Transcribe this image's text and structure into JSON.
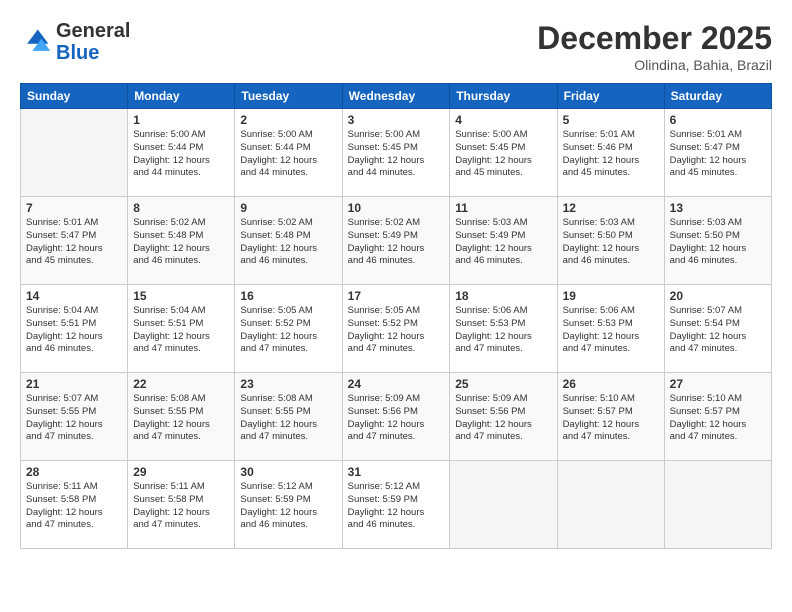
{
  "header": {
    "logo_line1": "General",
    "logo_line2": "Blue",
    "month": "December 2025",
    "location": "Olindina, Bahia, Brazil"
  },
  "weekdays": [
    "Sunday",
    "Monday",
    "Tuesday",
    "Wednesday",
    "Thursday",
    "Friday",
    "Saturday"
  ],
  "weeks": [
    [
      {
        "day": "",
        "info": ""
      },
      {
        "day": "1",
        "info": "Sunrise: 5:00 AM\nSunset: 5:44 PM\nDaylight: 12 hours\nand 44 minutes."
      },
      {
        "day": "2",
        "info": "Sunrise: 5:00 AM\nSunset: 5:44 PM\nDaylight: 12 hours\nand 44 minutes."
      },
      {
        "day": "3",
        "info": "Sunrise: 5:00 AM\nSunset: 5:45 PM\nDaylight: 12 hours\nand 44 minutes."
      },
      {
        "day": "4",
        "info": "Sunrise: 5:00 AM\nSunset: 5:45 PM\nDaylight: 12 hours\nand 45 minutes."
      },
      {
        "day": "5",
        "info": "Sunrise: 5:01 AM\nSunset: 5:46 PM\nDaylight: 12 hours\nand 45 minutes."
      },
      {
        "day": "6",
        "info": "Sunrise: 5:01 AM\nSunset: 5:47 PM\nDaylight: 12 hours\nand 45 minutes."
      }
    ],
    [
      {
        "day": "7",
        "info": "Sunrise: 5:01 AM\nSunset: 5:47 PM\nDaylight: 12 hours\nand 45 minutes."
      },
      {
        "day": "8",
        "info": "Sunrise: 5:02 AM\nSunset: 5:48 PM\nDaylight: 12 hours\nand 46 minutes."
      },
      {
        "day": "9",
        "info": "Sunrise: 5:02 AM\nSunset: 5:48 PM\nDaylight: 12 hours\nand 46 minutes."
      },
      {
        "day": "10",
        "info": "Sunrise: 5:02 AM\nSunset: 5:49 PM\nDaylight: 12 hours\nand 46 minutes."
      },
      {
        "day": "11",
        "info": "Sunrise: 5:03 AM\nSunset: 5:49 PM\nDaylight: 12 hours\nand 46 minutes."
      },
      {
        "day": "12",
        "info": "Sunrise: 5:03 AM\nSunset: 5:50 PM\nDaylight: 12 hours\nand 46 minutes."
      },
      {
        "day": "13",
        "info": "Sunrise: 5:03 AM\nSunset: 5:50 PM\nDaylight: 12 hours\nand 46 minutes."
      }
    ],
    [
      {
        "day": "14",
        "info": "Sunrise: 5:04 AM\nSunset: 5:51 PM\nDaylight: 12 hours\nand 46 minutes."
      },
      {
        "day": "15",
        "info": "Sunrise: 5:04 AM\nSunset: 5:51 PM\nDaylight: 12 hours\nand 47 minutes."
      },
      {
        "day": "16",
        "info": "Sunrise: 5:05 AM\nSunset: 5:52 PM\nDaylight: 12 hours\nand 47 minutes."
      },
      {
        "day": "17",
        "info": "Sunrise: 5:05 AM\nSunset: 5:52 PM\nDaylight: 12 hours\nand 47 minutes."
      },
      {
        "day": "18",
        "info": "Sunrise: 5:06 AM\nSunset: 5:53 PM\nDaylight: 12 hours\nand 47 minutes."
      },
      {
        "day": "19",
        "info": "Sunrise: 5:06 AM\nSunset: 5:53 PM\nDaylight: 12 hours\nand 47 minutes."
      },
      {
        "day": "20",
        "info": "Sunrise: 5:07 AM\nSunset: 5:54 PM\nDaylight: 12 hours\nand 47 minutes."
      }
    ],
    [
      {
        "day": "21",
        "info": "Sunrise: 5:07 AM\nSunset: 5:55 PM\nDaylight: 12 hours\nand 47 minutes."
      },
      {
        "day": "22",
        "info": "Sunrise: 5:08 AM\nSunset: 5:55 PM\nDaylight: 12 hours\nand 47 minutes."
      },
      {
        "day": "23",
        "info": "Sunrise: 5:08 AM\nSunset: 5:55 PM\nDaylight: 12 hours\nand 47 minutes."
      },
      {
        "day": "24",
        "info": "Sunrise: 5:09 AM\nSunset: 5:56 PM\nDaylight: 12 hours\nand 47 minutes."
      },
      {
        "day": "25",
        "info": "Sunrise: 5:09 AM\nSunset: 5:56 PM\nDaylight: 12 hours\nand 47 minutes."
      },
      {
        "day": "26",
        "info": "Sunrise: 5:10 AM\nSunset: 5:57 PM\nDaylight: 12 hours\nand 47 minutes."
      },
      {
        "day": "27",
        "info": "Sunrise: 5:10 AM\nSunset: 5:57 PM\nDaylight: 12 hours\nand 47 minutes."
      }
    ],
    [
      {
        "day": "28",
        "info": "Sunrise: 5:11 AM\nSunset: 5:58 PM\nDaylight: 12 hours\nand 47 minutes."
      },
      {
        "day": "29",
        "info": "Sunrise: 5:11 AM\nSunset: 5:58 PM\nDaylight: 12 hours\nand 47 minutes."
      },
      {
        "day": "30",
        "info": "Sunrise: 5:12 AM\nSunset: 5:59 PM\nDaylight: 12 hours\nand 46 minutes."
      },
      {
        "day": "31",
        "info": "Sunrise: 5:12 AM\nSunset: 5:59 PM\nDaylight: 12 hours\nand 46 minutes."
      },
      {
        "day": "",
        "info": ""
      },
      {
        "day": "",
        "info": ""
      },
      {
        "day": "",
        "info": ""
      }
    ]
  ]
}
